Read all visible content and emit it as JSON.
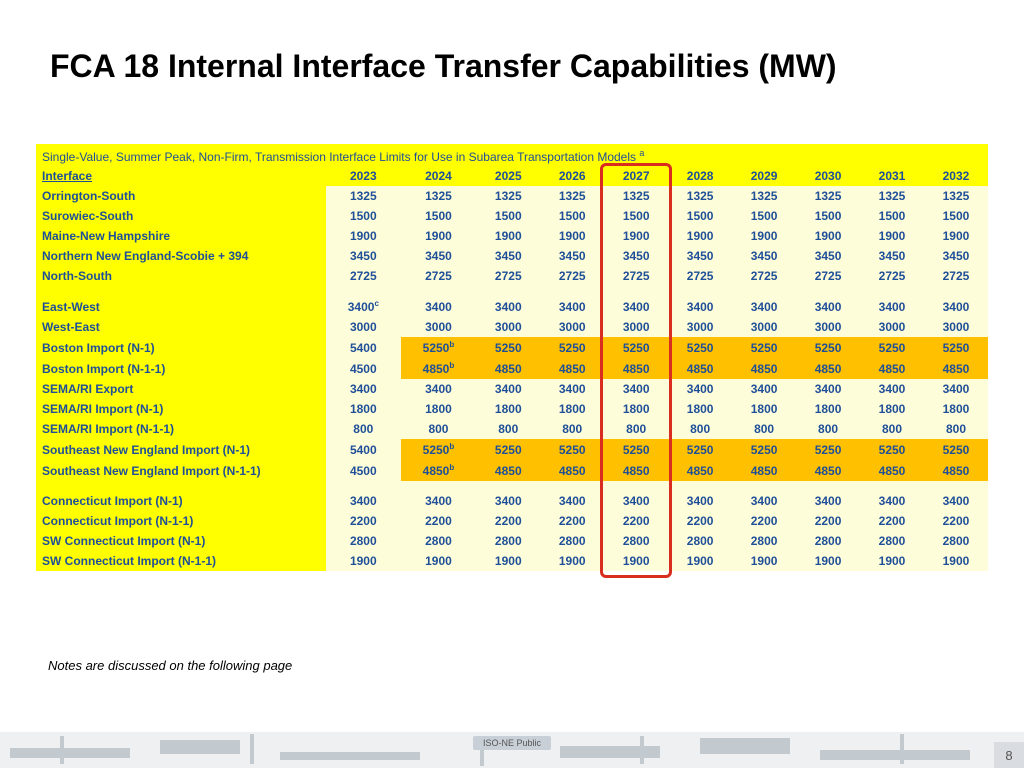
{
  "title": "FCA 18 Internal Interface Transfer Capabilities (MW)",
  "banner": "Single-Value, Summer Peak, Non-Firm, Transmission Interface Limits for Use in Subarea Transportation Models",
  "banner_sup": "a",
  "header": {
    "first": "Interface",
    "years": [
      "2023",
      "2024",
      "2025",
      "2026",
      "2027",
      "2028",
      "2029",
      "2030",
      "2031",
      "2032"
    ]
  },
  "highlight_col_index": 4,
  "groups": [
    {
      "rows": [
        {
          "name": "Orrington-South",
          "vals": [
            "1325",
            "1325",
            "1325",
            "1325",
            "1325",
            "1325",
            "1325",
            "1325",
            "1325",
            "1325"
          ]
        },
        {
          "name": "Surowiec-South",
          "vals": [
            "1500",
            "1500",
            "1500",
            "1500",
            "1500",
            "1500",
            "1500",
            "1500",
            "1500",
            "1500"
          ]
        },
        {
          "name": "Maine-New Hampshire",
          "vals": [
            "1900",
            "1900",
            "1900",
            "1900",
            "1900",
            "1900",
            "1900",
            "1900",
            "1900",
            "1900"
          ]
        },
        {
          "name": "Northern New England-Scobie + 394",
          "vals": [
            "3450",
            "3450",
            "3450",
            "3450",
            "3450",
            "3450",
            "3450",
            "3450",
            "3450",
            "3450"
          ]
        },
        {
          "name": "North-South",
          "vals": [
            "2725",
            "2725",
            "2725",
            "2725",
            "2725",
            "2725",
            "2725",
            "2725",
            "2725",
            "2725"
          ]
        }
      ]
    },
    {
      "rows": [
        {
          "name": "East-West",
          "vals": [
            "3400",
            "3400",
            "3400",
            "3400",
            "3400",
            "3400",
            "3400",
            "3400",
            "3400",
            "3400"
          ],
          "sup": [
            "c",
            "",
            "",
            "",
            "",
            "",
            "",
            "",
            "",
            ""
          ]
        },
        {
          "name": "West-East",
          "vals": [
            "3000",
            "3000",
            "3000",
            "3000",
            "3000",
            "3000",
            "3000",
            "3000",
            "3000",
            "3000"
          ]
        },
        {
          "name": "Boston Import (N-1)",
          "hl": true,
          "vals": [
            "5400",
            "5250",
            "5250",
            "5250",
            "5250",
            "5250",
            "5250",
            "5250",
            "5250",
            "5250"
          ],
          "sup": [
            "",
            "b",
            "",
            "",
            "",
            "",
            "",
            "",
            "",
            ""
          ]
        },
        {
          "name": "Boston Import (N-1-1)",
          "hl": true,
          "vals": [
            "4500",
            "4850",
            "4850",
            "4850",
            "4850",
            "4850",
            "4850",
            "4850",
            "4850",
            "4850"
          ],
          "sup": [
            "",
            "b",
            "",
            "",
            "",
            "",
            "",
            "",
            "",
            ""
          ]
        },
        {
          "name": "SEMA/RI Export",
          "vals": [
            "3400",
            "3400",
            "3400",
            "3400",
            "3400",
            "3400",
            "3400",
            "3400",
            "3400",
            "3400"
          ]
        },
        {
          "name": "SEMA/RI Import (N-1)",
          "vals": [
            "1800",
            "1800",
            "1800",
            "1800",
            "1800",
            "1800",
            "1800",
            "1800",
            "1800",
            "1800"
          ]
        },
        {
          "name": "SEMA/RI Import (N-1-1)",
          "vals": [
            "800",
            "800",
            "800",
            "800",
            "800",
            "800",
            "800",
            "800",
            "800",
            "800"
          ]
        },
        {
          "name": "Southeast New England Import (N-1)",
          "hl": true,
          "vals": [
            "5400",
            "5250",
            "5250",
            "5250",
            "5250",
            "5250",
            "5250",
            "5250",
            "5250",
            "5250"
          ],
          "sup": [
            "",
            "b",
            "",
            "",
            "",
            "",
            "",
            "",
            "",
            ""
          ]
        },
        {
          "name": "Southeast New England Import (N-1-1)",
          "hl": true,
          "vals": [
            "4500",
            "4850",
            "4850",
            "4850",
            "4850",
            "4850",
            "4850",
            "4850",
            "4850",
            "4850"
          ],
          "sup": [
            "",
            "b",
            "",
            "",
            "",
            "",
            "",
            "",
            "",
            ""
          ]
        }
      ]
    },
    {
      "rows": [
        {
          "name": "Connecticut Import (N-1)",
          "vals": [
            "3400",
            "3400",
            "3400",
            "3400",
            "3400",
            "3400",
            "3400",
            "3400",
            "3400",
            "3400"
          ]
        },
        {
          "name": "Connecticut Import (N-1-1)",
          "vals": [
            "2200",
            "2200",
            "2200",
            "2200",
            "2200",
            "2200",
            "2200",
            "2200",
            "2200",
            "2200"
          ]
        },
        {
          "name": "SW Connecticut Import (N-1)",
          "vals": [
            "2800",
            "2800",
            "2800",
            "2800",
            "2800",
            "2800",
            "2800",
            "2800",
            "2800",
            "2800"
          ]
        },
        {
          "name": "SW Connecticut Import (N-1-1)",
          "vals": [
            "1900",
            "1900",
            "1900",
            "1900",
            "1900",
            "1900",
            "1900",
            "1900",
            "1900",
            "1900"
          ]
        }
      ]
    }
  ],
  "note": "Notes are discussed on the following page",
  "footer_tag": "ISO-NE Public",
  "page_number": "8",
  "chart_data": {
    "type": "table",
    "title": "FCA 18 Internal Interface Transfer Capabilities (MW)",
    "columns": [
      "Interface",
      "2023",
      "2024",
      "2025",
      "2026",
      "2027",
      "2028",
      "2029",
      "2030",
      "2031",
      "2032"
    ],
    "rows": [
      [
        "Orrington-South",
        1325,
        1325,
        1325,
        1325,
        1325,
        1325,
        1325,
        1325,
        1325,
        1325
      ],
      [
        "Surowiec-South",
        1500,
        1500,
        1500,
        1500,
        1500,
        1500,
        1500,
        1500,
        1500,
        1500
      ],
      [
        "Maine-New Hampshire",
        1900,
        1900,
        1900,
        1900,
        1900,
        1900,
        1900,
        1900,
        1900,
        1900
      ],
      [
        "Northern New England-Scobie + 394",
        3450,
        3450,
        3450,
        3450,
        3450,
        3450,
        3450,
        3450,
        3450,
        3450
      ],
      [
        "North-South",
        2725,
        2725,
        2725,
        2725,
        2725,
        2725,
        2725,
        2725,
        2725,
        2725
      ],
      [
        "East-West",
        3400,
        3400,
        3400,
        3400,
        3400,
        3400,
        3400,
        3400,
        3400,
        3400
      ],
      [
        "West-East",
        3000,
        3000,
        3000,
        3000,
        3000,
        3000,
        3000,
        3000,
        3000,
        3000
      ],
      [
        "Boston Import (N-1)",
        5400,
        5250,
        5250,
        5250,
        5250,
        5250,
        5250,
        5250,
        5250,
        5250
      ],
      [
        "Boston Import (N-1-1)",
        4500,
        4850,
        4850,
        4850,
        4850,
        4850,
        4850,
        4850,
        4850,
        4850
      ],
      [
        "SEMA/RI Export",
        3400,
        3400,
        3400,
        3400,
        3400,
        3400,
        3400,
        3400,
        3400,
        3400
      ],
      [
        "SEMA/RI Import (N-1)",
        1800,
        1800,
        1800,
        1800,
        1800,
        1800,
        1800,
        1800,
        1800,
        1800
      ],
      [
        "SEMA/RI Import (N-1-1)",
        800,
        800,
        800,
        800,
        800,
        800,
        800,
        800,
        800,
        800
      ],
      [
        "Southeast New England Import (N-1)",
        5400,
        5250,
        5250,
        5250,
        5250,
        5250,
        5250,
        5250,
        5250,
        5250
      ],
      [
        "Southeast New England Import (N-1-1)",
        4500,
        4850,
        4850,
        4850,
        4850,
        4850,
        4850,
        4850,
        4850,
        4850
      ],
      [
        "Connecticut Import (N-1)",
        3400,
        3400,
        3400,
        3400,
        3400,
        3400,
        3400,
        3400,
        3400,
        3400
      ],
      [
        "Connecticut Import (N-1-1)",
        2200,
        2200,
        2200,
        2200,
        2200,
        2200,
        2200,
        2200,
        2200,
        2200
      ],
      [
        "SW Connecticut Import (N-1)",
        2800,
        2800,
        2800,
        2800,
        2800,
        2800,
        2800,
        2800,
        2800,
        2800
      ],
      [
        "SW Connecticut Import (N-1-1)",
        1900,
        1900,
        1900,
        1900,
        1900,
        1900,
        1900,
        1900,
        1900,
        1900
      ]
    ],
    "highlighted_column": "2027",
    "highlighted_rows": [
      "Boston Import (N-1)",
      "Boston Import (N-1-1)",
      "Southeast New England Import (N-1)",
      "Southeast New England Import (N-1-1)"
    ]
  }
}
